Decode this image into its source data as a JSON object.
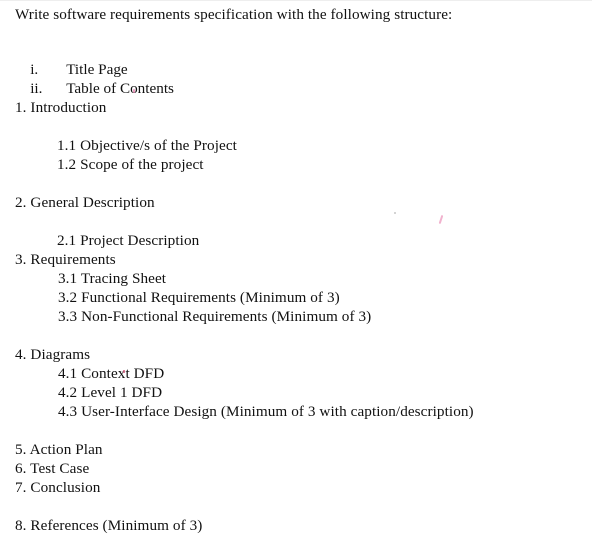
{
  "document": {
    "prompt_line": "Write software requirements specification with the following structure:",
    "roman_items": [
      {
        "marker": "i.",
        "label": "Title Page"
      },
      {
        "marker": "ii.",
        "label": "Table of Contents"
      }
    ],
    "sections": [
      {
        "number": "1.",
        "title": "Introduction",
        "text": "1. Introduction"
      },
      {
        "text": "1.1 Objective/s of the Project"
      },
      {
        "text": "1.2 Scope of the project"
      },
      {
        "number": "2.",
        "title": "General Description",
        "text": "2. General Description"
      },
      {
        "text": "2.1 Project Description"
      },
      {
        "number": "3.",
        "title": "Requirements",
        "text": "3. Requirements"
      },
      {
        "text": "3.1 Tracing Sheet"
      },
      {
        "text": "3.2 Functional Requirements (Minimum of 3)"
      },
      {
        "text": "3.3 Non-Functional Requirements (Minimum of 3)"
      },
      {
        "number": "4.",
        "title": "Diagrams",
        "text": "4. Diagrams"
      },
      {
        "text": "4.1 Context DFD"
      },
      {
        "text": "4.2 Level 1 DFD"
      },
      {
        "text": "4.3 User-Interface Design (Minimum of 3 with caption/description)"
      },
      {
        "number": "5.",
        "title": "Action Plan",
        "text": "5. Action Plan"
      },
      {
        "number": "6.",
        "title": "Test Case",
        "text": "6. Test Case"
      },
      {
        "number": "7.",
        "title": "Conclusion",
        "text": "7. Conclusion"
      },
      {
        "number": "8.",
        "title": "References (Minimum of 3)",
        "text": "8. References (Minimum of 3)"
      }
    ]
  },
  "colors": {
    "page_background": "#ffffff",
    "text": "#111111",
    "artifact_pink": "#e87fae",
    "scan_edge": "#eeeeee"
  }
}
